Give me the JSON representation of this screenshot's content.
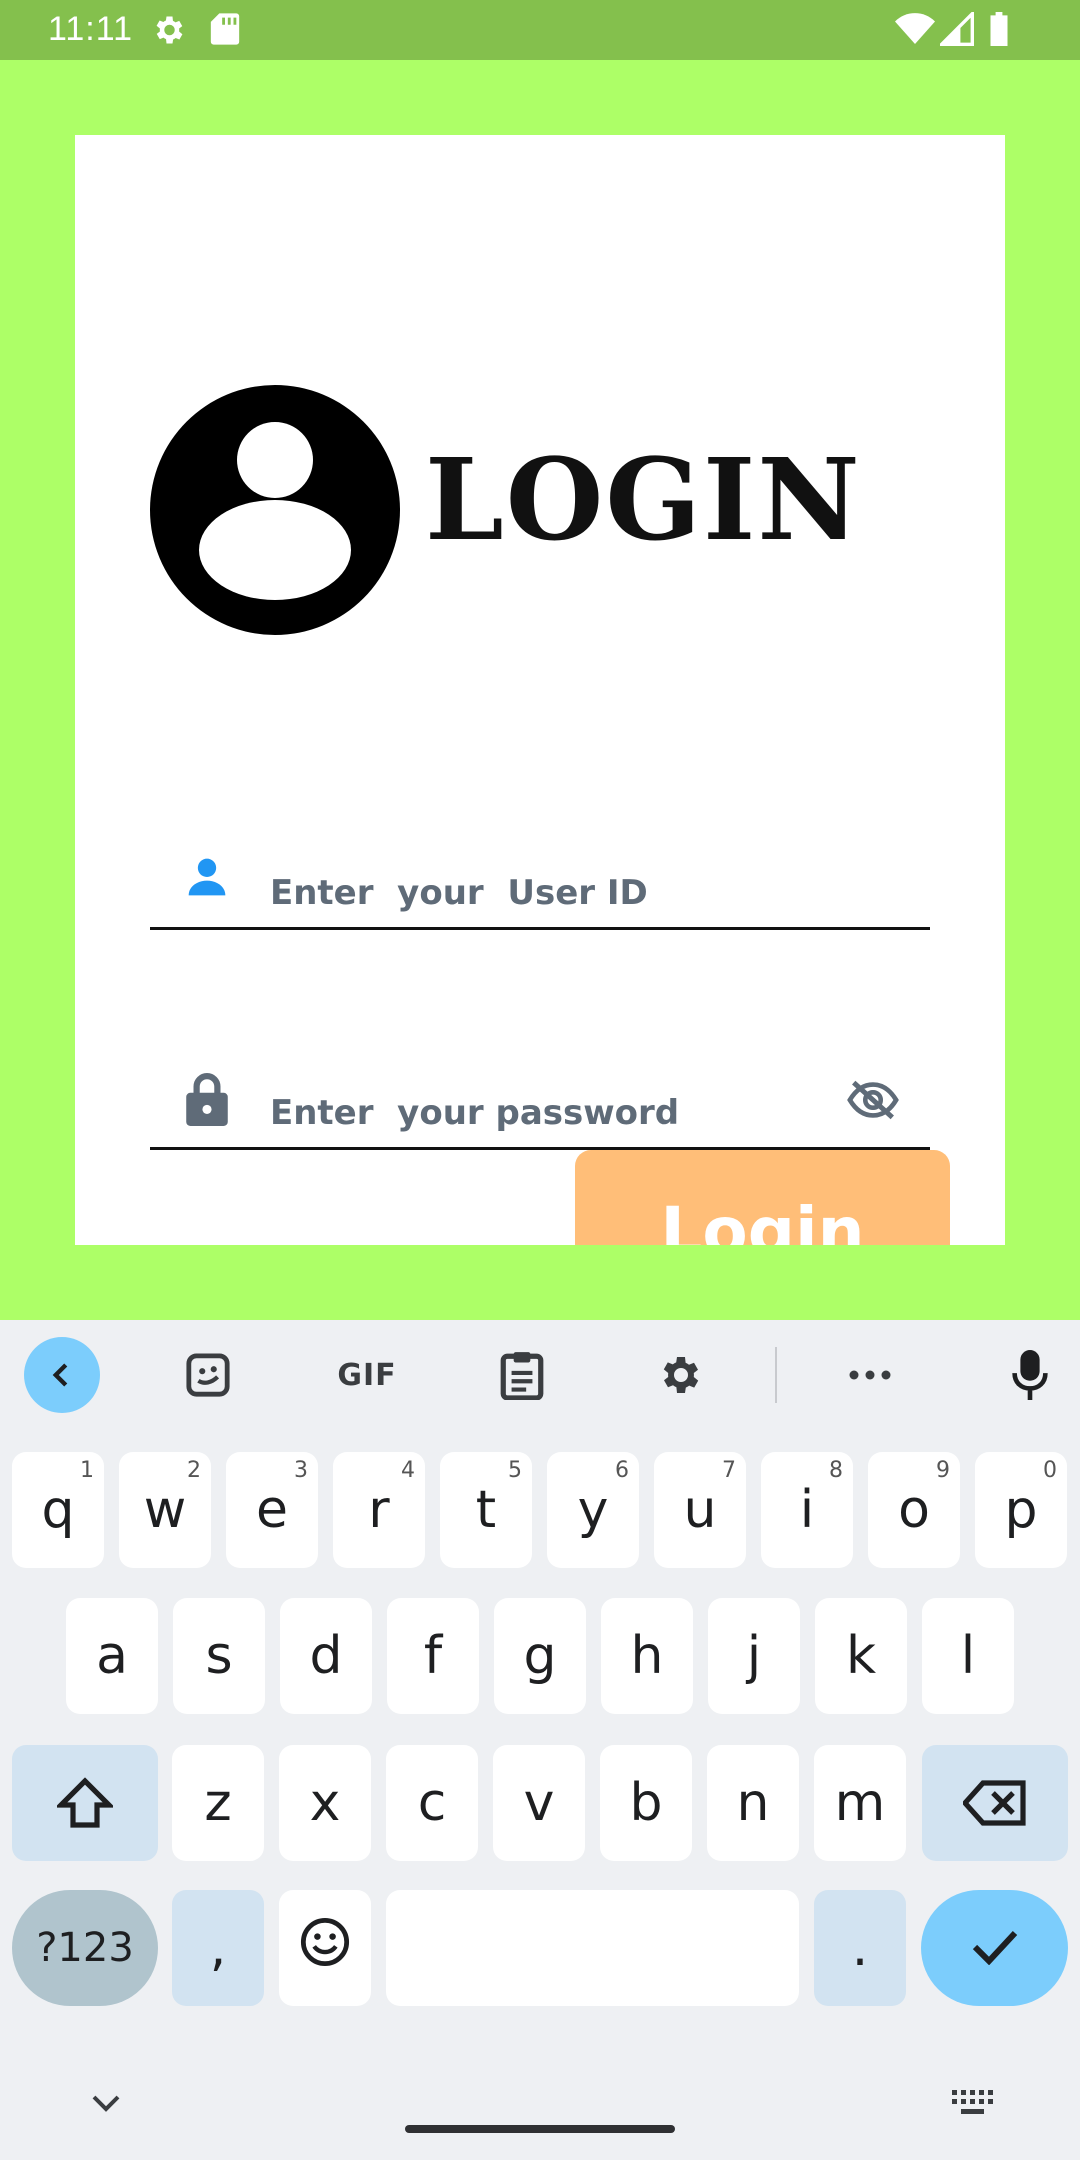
{
  "status_bar": {
    "time": "11:11",
    "icons": [
      "gear-icon",
      "sd-card-icon",
      "wifi-icon",
      "signal-icon",
      "battery-icon"
    ]
  },
  "card": {
    "title": "LOGIN",
    "user_field": {
      "placeholder": "Enter  your  User ID",
      "value": "",
      "icon": "person-icon"
    },
    "password_field": {
      "placeholder": "Enter  your password",
      "value": "",
      "icon": "lock-icon",
      "toggle_icon": "eye-off-icon"
    },
    "login_button": "Login"
  },
  "keyboard": {
    "toolbar": {
      "icons": [
        "chevron-left-icon",
        "sticker-icon",
        "gif-icon",
        "clipboard-icon",
        "gear-icon",
        "more-icon",
        "microphone-icon"
      ],
      "gif_label": "GIF"
    },
    "row1": [
      {
        "key": "q",
        "hint": "1"
      },
      {
        "key": "w",
        "hint": "2"
      },
      {
        "key": "e",
        "hint": "3"
      },
      {
        "key": "r",
        "hint": "4"
      },
      {
        "key": "t",
        "hint": "5"
      },
      {
        "key": "y",
        "hint": "6"
      },
      {
        "key": "u",
        "hint": "7"
      },
      {
        "key": "i",
        "hint": "8"
      },
      {
        "key": "o",
        "hint": "9"
      },
      {
        "key": "p",
        "hint": "0"
      }
    ],
    "row2": [
      "a",
      "s",
      "d",
      "f",
      "g",
      "h",
      "j",
      "k",
      "l"
    ],
    "row3": [
      "z",
      "x",
      "c",
      "v",
      "b",
      "n",
      "m"
    ],
    "symbols_label": "?123",
    "comma": ",",
    "period": ".",
    "colors": {
      "accent": "#7ccdfc",
      "modifier": "#d2e3f1"
    }
  },
  "colors": {
    "background": "#adff67",
    "status_bar": "#84c04d",
    "login_button": "#ffbe78",
    "user_icon": "#2196f3"
  }
}
